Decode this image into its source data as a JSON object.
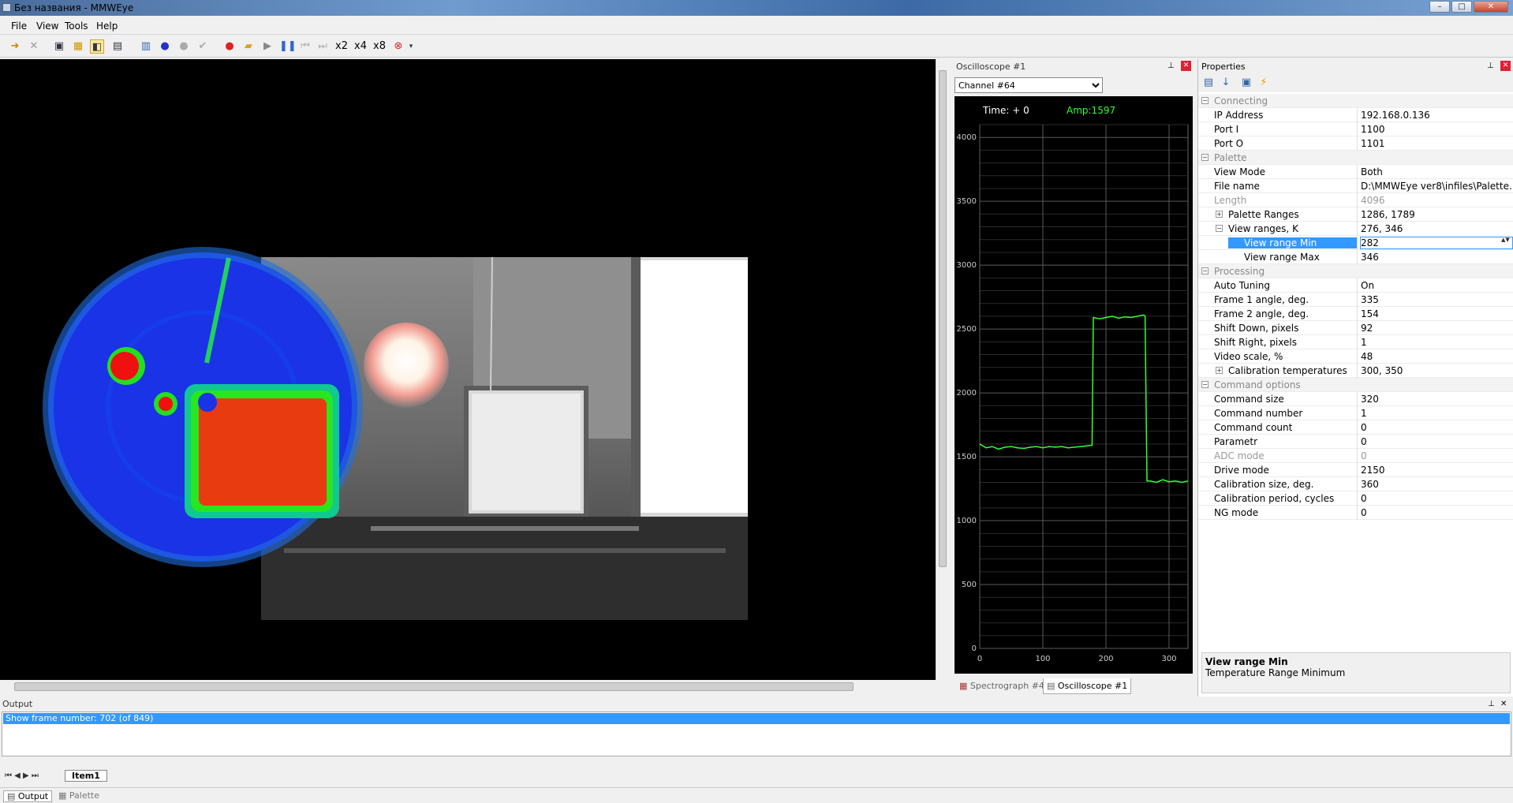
{
  "window": {
    "title": "Без названия - MMWEye"
  },
  "menu": [
    "File",
    "View",
    "Tools",
    "Help"
  ],
  "toolbar": {
    "zoom_labels": [
      "x2",
      "x4",
      "x8"
    ]
  },
  "oscilloscope": {
    "title": "Oscilloscope #1",
    "channel": "Channel #64",
    "time_label": "Time: +  0",
    "amp_label": "Amp:1597",
    "tabs": [
      "Spectrograph #4",
      "Oscilloscope #1"
    ]
  },
  "chart_data": {
    "type": "line",
    "x": [
      0,
      10,
      20,
      30,
      40,
      50,
      60,
      70,
      80,
      90,
      100,
      110,
      120,
      130,
      140,
      150,
      160,
      170,
      178,
      180,
      190,
      200,
      210,
      220,
      230,
      240,
      250,
      260,
      262,
      265,
      270,
      280,
      290,
      300,
      310,
      320,
      330
    ],
    "y": [
      1600,
      1570,
      1580,
      1560,
      1575,
      1580,
      1570,
      1565,
      1575,
      1580,
      1570,
      1580,
      1575,
      1580,
      1570,
      1575,
      1580,
      1585,
      1590,
      2590,
      2580,
      2590,
      2600,
      2585,
      2595,
      2590,
      2600,
      2610,
      2600,
      1310,
      1310,
      1300,
      1320,
      1305,
      1310,
      1300,
      1310
    ],
    "xlim": [
      0,
      330
    ],
    "ylim": [
      0,
      4100
    ],
    "xticks": [
      0,
      100,
      200,
      300
    ],
    "yticks": [
      0,
      500,
      1000,
      1500,
      2000,
      2500,
      3000,
      3500,
      4000
    ],
    "grid": true,
    "line_color": "#33ff33"
  },
  "properties": {
    "title": "Properties",
    "rows": [
      {
        "kind": "cat",
        "name": "Connecting"
      },
      {
        "kind": "row",
        "name": "IP Address",
        "value": "192.168.0.136"
      },
      {
        "kind": "row",
        "name": "Port I",
        "value": "1100"
      },
      {
        "kind": "row",
        "name": "Port O",
        "value": "1101"
      },
      {
        "kind": "cat",
        "name": "Palette"
      },
      {
        "kind": "row",
        "name": "View Mode",
        "value": "Both"
      },
      {
        "kind": "row",
        "name": "File name",
        "value": "D:\\MMWEye ver8\\infiles\\Palette..."
      },
      {
        "kind": "dis",
        "name": "Length",
        "value": "4096"
      },
      {
        "kind": "exp",
        "name": "Palette Ranges",
        "value": "1286, 1789"
      },
      {
        "kind": "col",
        "name": "View ranges, K",
        "value": "276, 346"
      },
      {
        "kind": "sel",
        "name": "View range Min",
        "value": "282"
      },
      {
        "kind": "subsub",
        "name": "View range Max",
        "value": "346"
      },
      {
        "kind": "cat",
        "name": "Processing"
      },
      {
        "kind": "row",
        "name": "Auto Tuning",
        "value": "On"
      },
      {
        "kind": "row",
        "name": "Frame 1 angle, deg.",
        "value": "335"
      },
      {
        "kind": "row",
        "name": "Frame 2 angle, deg.",
        "value": "154"
      },
      {
        "kind": "row",
        "name": "Shift Down, pixels",
        "value": "92"
      },
      {
        "kind": "row",
        "name": "Shift Right, pixels",
        "value": "1"
      },
      {
        "kind": "row",
        "name": "Video scale, %",
        "value": "48"
      },
      {
        "kind": "exp",
        "name": "Calibration temperatures",
        "value": "300, 350"
      },
      {
        "kind": "cat",
        "name": "Command options"
      },
      {
        "kind": "row",
        "name": "Command size",
        "value": "320"
      },
      {
        "kind": "row",
        "name": "Command number",
        "value": "1"
      },
      {
        "kind": "row",
        "name": "Command count",
        "value": "0"
      },
      {
        "kind": "row",
        "name": "Parametr",
        "value": "0"
      },
      {
        "kind": "dis",
        "name": "ADC mode",
        "value": "0"
      },
      {
        "kind": "row",
        "name": "Drive mode",
        "value": "2150"
      },
      {
        "kind": "row",
        "name": "Calibration size, deg.",
        "value": "360"
      },
      {
        "kind": "row",
        "name": "Calibration period, cycles",
        "value": "0"
      },
      {
        "kind": "row",
        "name": "NG mode",
        "value": "0"
      }
    ],
    "desc_title": "View range Min",
    "desc_text": "Temperature Range Minimum"
  },
  "output": {
    "title": "Output",
    "line": "Show frame number: 702 (of 849)",
    "sheet_tab": "Item1"
  },
  "bottom_tabs": [
    "Output",
    "Palette"
  ]
}
